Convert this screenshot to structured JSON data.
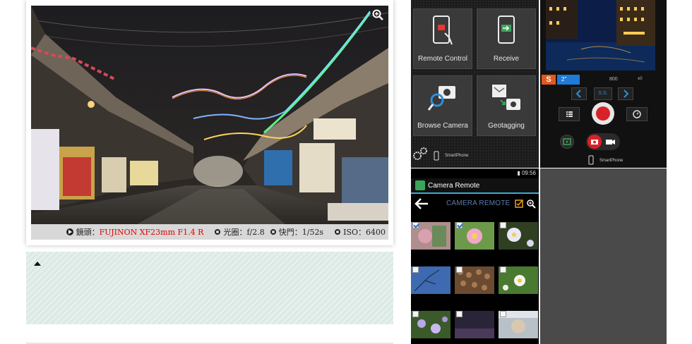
{
  "photo_caption": {
    "lens_label": "鏡頭：",
    "lens_value": "FUJINON XF23mm F1.4 R",
    "aperture_label": "光圈：",
    "aperture_value": "f/2.8",
    "shutter_label": "快門：",
    "shutter_value": "1/52s",
    "iso_label": "ISO：",
    "iso_value": "6400"
  },
  "menu_screen": {
    "tiles": [
      {
        "label": "Remote Control",
        "icon": "phone-touch-icon"
      },
      {
        "label": "Receive",
        "icon": "phone-receive-icon"
      },
      {
        "label": "Browse Camera",
        "icon": "camera-magnifier-icon"
      },
      {
        "label": "Geotagging",
        "icon": "map-camera-icon"
      }
    ],
    "footer_label": "SmartPhone"
  },
  "camera_screen": {
    "mode": "S",
    "shutter": "2\"",
    "iso": "800",
    "ev": "±0",
    "ss_label": "S.S.",
    "footer_label": "SmartPhone"
  },
  "grid_screen": {
    "status_time": "09:56",
    "app_title": "Camera Remote",
    "header_title": "CAMERA REMOTE",
    "thumbnails": [
      {
        "checked": true
      },
      {
        "checked": true
      },
      {
        "checked": false
      },
      {
        "checked": false
      },
      {
        "checked": false
      },
      {
        "checked": false
      },
      {
        "checked": false
      },
      {
        "checked": false
      },
      {
        "checked": false
      }
    ]
  },
  "colors": {
    "accent_blue": "#1f7ad8",
    "mode_orange": "#e05a1f",
    "record_red": "#d8222a",
    "lens_red": "#e00000",
    "panel_hatch": "#dbe9e4"
  }
}
